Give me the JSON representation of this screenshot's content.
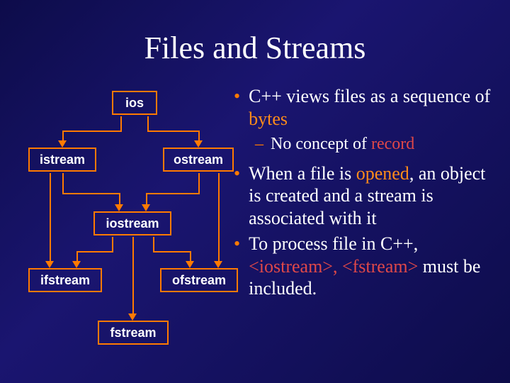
{
  "title": "Files and Streams",
  "diagram": {
    "nodes": {
      "ios": "ios",
      "istream": "istream",
      "ostream": "ostream",
      "iostream": "iostream",
      "ifstream": "ifstream",
      "ofstream": "ofstream",
      "fstream": "fstream"
    }
  },
  "bullets": {
    "b1_pre": "C++ views files as a sequence of ",
    "b1_hl": "bytes",
    "sub_pre": "No concept of ",
    "sub_hl": "record",
    "b2_pre": "When a file is ",
    "b2_hl": "opened",
    "b2_post": ", an object is created and a stream is associated with it",
    "b3_pre": "To process file in C++, ",
    "b3_hl": "<iostream>, <fstream>",
    "b3_post": " must be included."
  }
}
